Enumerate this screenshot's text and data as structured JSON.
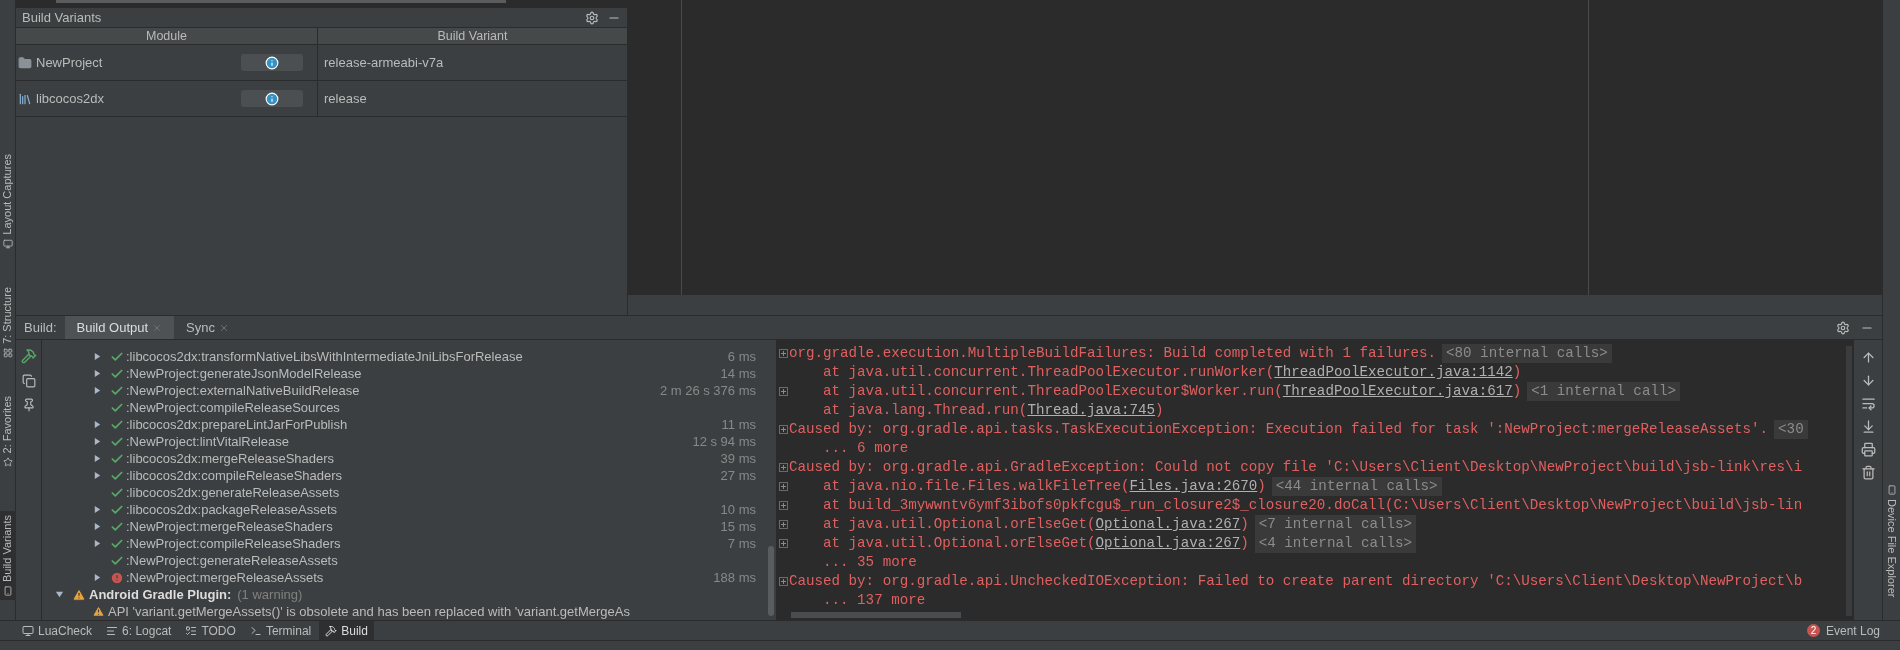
{
  "side_tabs": [
    {
      "label": "Layout Captures",
      "selected": false
    },
    {
      "label": "7: Structure",
      "selected": false
    },
    {
      "label": "2: Favorites",
      "selected": false
    },
    {
      "label": "Build Variants",
      "selected": true
    }
  ],
  "build_variants": {
    "title": "Build Variants",
    "columns": [
      "Module",
      "Build Variant"
    ],
    "rows": [
      {
        "module": "NewProject",
        "kind": "app",
        "variant": "release-armeabi-v7a"
      },
      {
        "module": "libcocos2dx",
        "kind": "library",
        "variant": "release"
      }
    ]
  },
  "build_window": {
    "label": "Build:",
    "tabs": [
      {
        "label": "Build Output",
        "selected": true
      },
      {
        "label": "Sync",
        "selected": false
      }
    ],
    "tasks": [
      {
        "expandable": true,
        "failed": false,
        "name": ":libcocos2dx:transformNativeLibsWithIntermediateJniLibsForRelease",
        "time": "6 ms"
      },
      {
        "expandable": true,
        "failed": false,
        "name": ":NewProject:generateJsonModelRelease",
        "time": "14 ms"
      },
      {
        "expandable": true,
        "failed": false,
        "name": ":NewProject:externalNativeBuildRelease",
        "time": "2 m 26 s 376 ms"
      },
      {
        "expandable": false,
        "failed": false,
        "name": ":NewProject:compileReleaseSources"
      },
      {
        "expandable": true,
        "failed": false,
        "name": ":libcocos2dx:prepareLintJarForPublish",
        "time": "11 ms"
      },
      {
        "expandable": true,
        "failed": false,
        "name": ":NewProject:lintVitalRelease",
        "time": "12 s 94 ms"
      },
      {
        "expandable": true,
        "failed": false,
        "name": ":libcocos2dx:mergeReleaseShaders",
        "time": "39 ms"
      },
      {
        "expandable": true,
        "failed": false,
        "name": ":libcocos2dx:compileReleaseShaders",
        "time": "27 ms"
      },
      {
        "expandable": false,
        "failed": false,
        "name": ":libcocos2dx:generateReleaseAssets"
      },
      {
        "expandable": true,
        "failed": false,
        "name": ":libcocos2dx:packageReleaseAssets",
        "time": "10 ms"
      },
      {
        "expandable": true,
        "failed": false,
        "name": ":NewProject:mergeReleaseShaders",
        "time": "15 ms"
      },
      {
        "expandable": true,
        "failed": false,
        "name": ":NewProject:compileReleaseShaders",
        "time": "7 ms"
      },
      {
        "expandable": false,
        "failed": false,
        "name": ":NewProject:generateReleaseAssets"
      },
      {
        "expandable": true,
        "failed": true,
        "name": ":NewProject:mergeReleaseAssets",
        "time": "188 ms"
      }
    ],
    "warning_group": {
      "title": "Android Gradle Plugin:",
      "count": "(1 warning)",
      "expanded": true,
      "messages": [
        "API 'variant.getMergeAssets()' is obsolete and has been replaced with 'variant.getMergeAs"
      ]
    },
    "console": [
      {
        "foldable": true,
        "segments": [
          {
            "kind": "text",
            "text": "org.gradle.execution.MultipleBuildFailures: Build completed with 1 failures."
          },
          {
            "kind": "fold",
            "text": "<80 internal calls>"
          }
        ]
      },
      {
        "foldable": false,
        "segments": [
          {
            "kind": "text",
            "text": "    at java.util.concurrent.ThreadPoolExecutor.runWorker("
          },
          {
            "kind": "link",
            "text": "ThreadPoolExecutor.java:1142"
          },
          {
            "kind": "text",
            "text": ")"
          }
        ]
      },
      {
        "foldable": true,
        "segments": [
          {
            "kind": "text",
            "text": "    at java.util.concurrent.ThreadPoolExecutor$Worker.run("
          },
          {
            "kind": "link",
            "text": "ThreadPoolExecutor.java:617"
          },
          {
            "kind": "text",
            "text": ")"
          },
          {
            "kind": "fold",
            "text": "<1 internal call>"
          }
        ]
      },
      {
        "foldable": false,
        "segments": [
          {
            "kind": "text",
            "text": "    at java.lang.Thread.run("
          },
          {
            "kind": "link",
            "text": "Thread.java:745"
          },
          {
            "kind": "text",
            "text": ")"
          }
        ]
      },
      {
        "foldable": true,
        "segments": [
          {
            "kind": "text",
            "text": "Caused by: org.gradle.api.tasks.TaskExecutionException: Execution failed for task ':NewProject:mergeReleaseAssets'."
          },
          {
            "kind": "fold",
            "text": "<30"
          }
        ]
      },
      {
        "foldable": false,
        "segments": [
          {
            "kind": "text",
            "text": "    ... 6 more"
          }
        ]
      },
      {
        "foldable": true,
        "segments": [
          {
            "kind": "text",
            "text": "Caused by: org.gradle.api.GradleException: Could not copy file 'C:\\Users\\Client\\Desktop\\NewProject\\build\\jsb-link\\res\\i"
          }
        ]
      },
      {
        "foldable": true,
        "segments": [
          {
            "kind": "text",
            "text": "    at java.nio.file.Files.walkFileTree("
          },
          {
            "kind": "link",
            "text": "Files.java:2670"
          },
          {
            "kind": "text",
            "text": ")"
          },
          {
            "kind": "fold",
            "text": "<44 internal calls>"
          }
        ]
      },
      {
        "foldable": true,
        "segments": [
          {
            "kind": "text",
            "text": "    at build_3mywwntv6ymf3ibofs0pkfcgu$_run_closure2$_closure20.doCall(C:\\Users\\Client\\Desktop\\NewProject\\build\\jsb-lin"
          }
        ]
      },
      {
        "foldable": true,
        "segments": [
          {
            "kind": "text",
            "text": "    at java.util.Optional.orElseGet("
          },
          {
            "kind": "link",
            "text": "Optional.java:267"
          },
          {
            "kind": "text",
            "text": ")"
          },
          {
            "kind": "fold",
            "text": "<7 internal calls>"
          }
        ]
      },
      {
        "foldable": true,
        "segments": [
          {
            "kind": "text",
            "text": "    at java.util.Optional.orElseGet("
          },
          {
            "kind": "link",
            "text": "Optional.java:267"
          },
          {
            "kind": "text",
            "text": ")"
          },
          {
            "kind": "fold",
            "text": "<4 internal calls>"
          }
        ]
      },
      {
        "foldable": false,
        "segments": [
          {
            "kind": "text",
            "text": "    ... 35 more"
          }
        ]
      },
      {
        "foldable": true,
        "segments": [
          {
            "kind": "text",
            "text": "Caused by: org.gradle.api.UncheckedIOException: Failed to create parent directory 'C:\\Users\\Client\\Desktop\\NewProject\\b"
          }
        ]
      },
      {
        "foldable": false,
        "segments": [
          {
            "kind": "text",
            "text": "    ... 137 more"
          }
        ]
      }
    ]
  },
  "bottom_tabs": [
    {
      "label": "LuaCheck",
      "selected": false
    },
    {
      "label": "6: Logcat",
      "selected": false
    },
    {
      "label": "TODO",
      "selected": false
    },
    {
      "label": "Terminal",
      "selected": false
    },
    {
      "label": "Build",
      "selected": true
    }
  ],
  "event_log": {
    "count": "2",
    "label": "Event Log"
  },
  "right_tabs": [
    {
      "label": "Device File Explorer"
    }
  ]
}
